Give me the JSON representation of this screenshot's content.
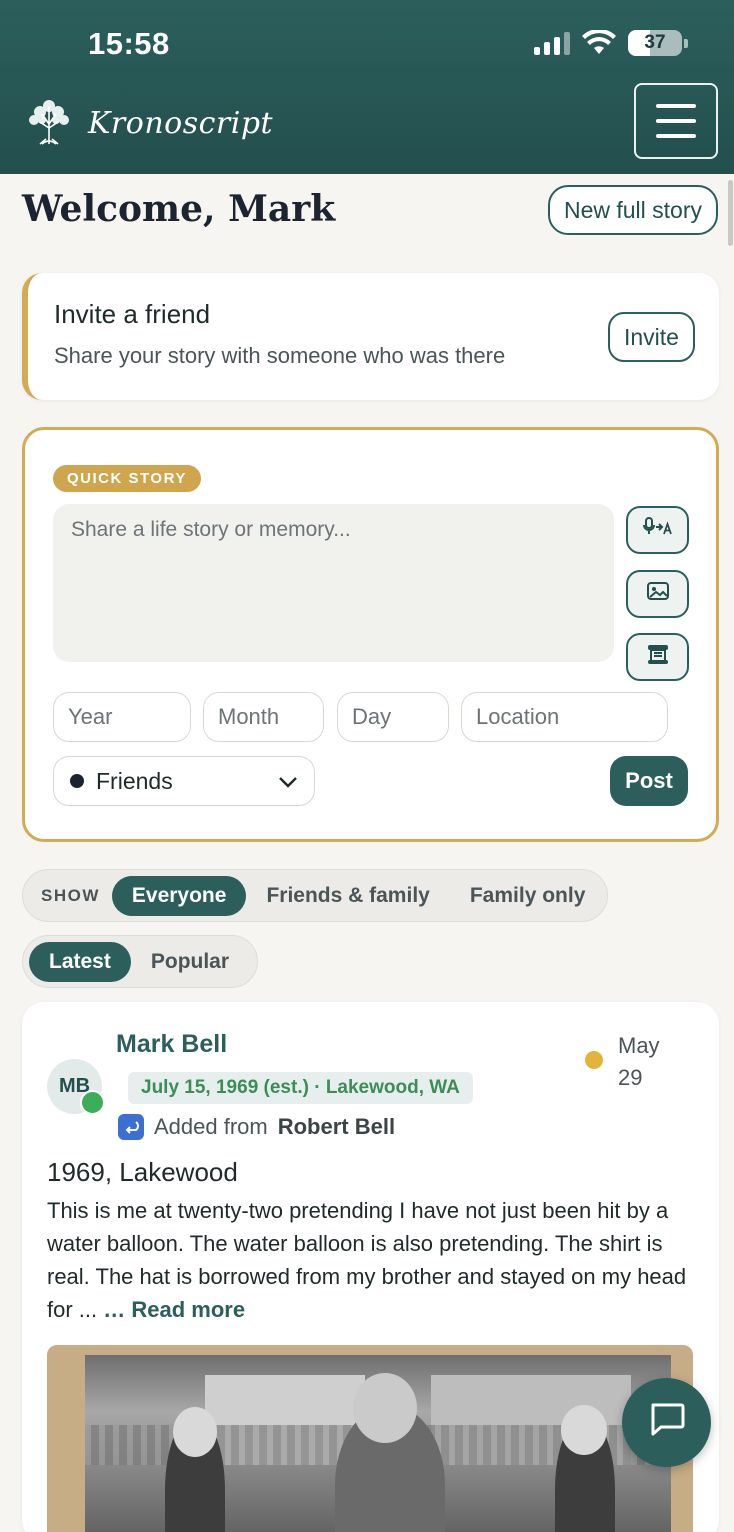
{
  "status_bar": {
    "time": "15:58",
    "battery": "37"
  },
  "header": {
    "brand": "Kronoscript"
  },
  "welcome": {
    "title": "Welcome, Mark",
    "new_story_label": "New full story"
  },
  "invite": {
    "title": "Invite a friend",
    "subtitle": "Share your story with someone who was there",
    "button_label": "Invite"
  },
  "quick_story": {
    "badge": "QUICK STORY",
    "placeholder": "Share a life story or memory...",
    "year_placeholder": "Year",
    "month_placeholder": "Month",
    "day_placeholder": "Day",
    "location_placeholder": "Location",
    "visibility": "Friends",
    "post_label": "Post"
  },
  "filters": {
    "show_label": "SHOW",
    "audience": [
      {
        "label": "Everyone",
        "active": true
      },
      {
        "label": "Friends & family",
        "active": false
      },
      {
        "label": "Family only",
        "active": false
      }
    ],
    "sort": [
      {
        "label": "Latest",
        "active": true
      },
      {
        "label": "Popular",
        "active": false
      }
    ]
  },
  "post": {
    "avatar_initials": "MB",
    "author": "Mark Bell",
    "meta": "July 15, 1969 (est.) · Lakewood, WA",
    "added_prefix": "Added from",
    "added_from": "Robert Bell",
    "date_month": "May",
    "date_day": "29",
    "title": "1969, Lakewood",
    "body": "This is me at twenty-two pretending I have not just been hit by a water balloon. The water balloon is also pretending. The shirt is real. The hat is borrowed from my brother and stayed on my head for ...",
    "read_more": "… Read more"
  },
  "colors": {
    "primary": "#2c5f5c",
    "gold": "#d2ab55",
    "online": "#3cae5a",
    "date_dot": "#e2b43c"
  },
  "icons": {
    "dictation": "voice-to-text-icon",
    "photo": "image-icon",
    "scroll": "scroll-icon",
    "chat": "chat-bubble-icon"
  }
}
